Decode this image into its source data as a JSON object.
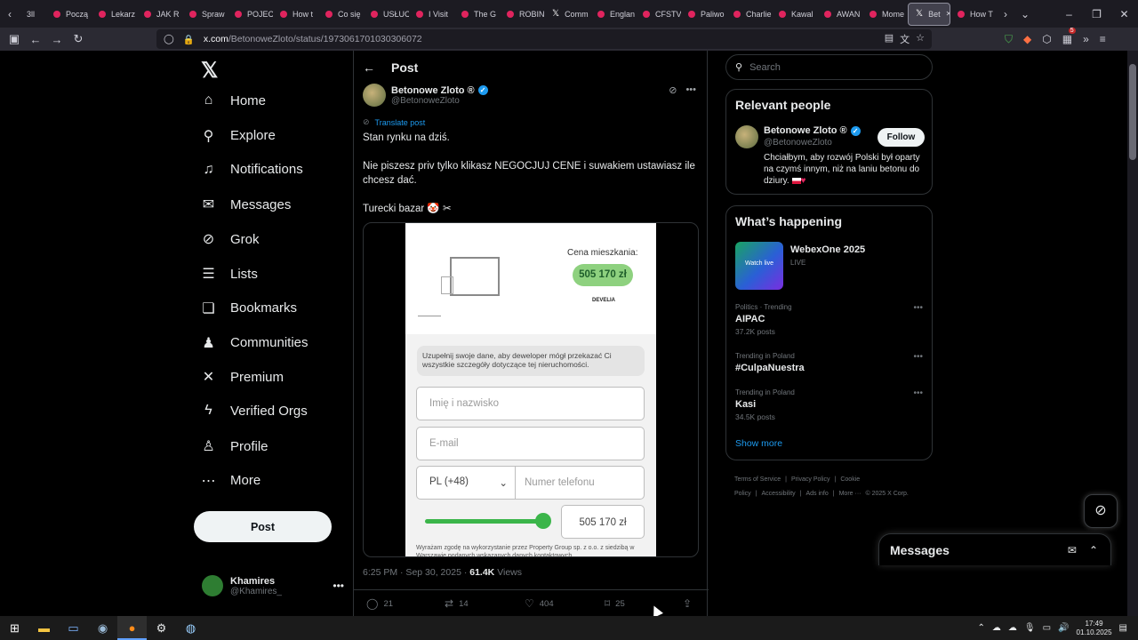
{
  "browser": {
    "tabs": [
      {
        "label": "3ll",
        "kind": "leading"
      },
      {
        "label": "Począ",
        "kind": "red"
      },
      {
        "label": "Lekarz",
        "kind": "red"
      },
      {
        "label": "JAK R",
        "kind": "red"
      },
      {
        "label": "Spraw",
        "kind": "red"
      },
      {
        "label": "POJEC",
        "kind": "red"
      },
      {
        "label": "How t",
        "kind": "red"
      },
      {
        "label": "Co się",
        "kind": "red"
      },
      {
        "label": "USŁUC",
        "kind": "red"
      },
      {
        "label": "I Visit",
        "kind": "red"
      },
      {
        "label": "The G",
        "kind": "red"
      },
      {
        "label": "ROBIN",
        "kind": "red"
      },
      {
        "label": "Comm",
        "kind": "x"
      },
      {
        "label": "Englan",
        "kind": "red"
      },
      {
        "label": "CFSTV",
        "kind": "red"
      },
      {
        "label": "Paliwo",
        "kind": "red"
      },
      {
        "label": "Charlie",
        "kind": "red"
      },
      {
        "label": "Kawal",
        "kind": "red"
      },
      {
        "label": "AWAN",
        "kind": "red"
      },
      {
        "label": "Mome",
        "kind": "red"
      },
      {
        "label": "Bet",
        "kind": "x-active"
      },
      {
        "label": "How T",
        "kind": "red"
      }
    ],
    "url_domain": "x.com",
    "url_path": "/BetonoweZloto/status/1973061701030306072",
    "notification_badge": "5"
  },
  "nav": {
    "items": [
      {
        "label": "Home",
        "icon": "⌂",
        "name": "home"
      },
      {
        "label": "Explore",
        "icon": "⚲",
        "name": "explore"
      },
      {
        "label": "Notifications",
        "icon": "♫",
        "name": "notifications"
      },
      {
        "label": "Messages",
        "icon": "✉",
        "name": "messages"
      },
      {
        "label": "Grok",
        "icon": "⊘",
        "name": "grok"
      },
      {
        "label": "Lists",
        "icon": "☰",
        "name": "lists"
      },
      {
        "label": "Bookmarks",
        "icon": "❏",
        "name": "bookmarks"
      },
      {
        "label": "Communities",
        "icon": "♟",
        "name": "communities"
      },
      {
        "label": "Premium",
        "icon": "✕",
        "name": "premium"
      },
      {
        "label": "Verified Orgs",
        "icon": "ϟ",
        "name": "verified-orgs"
      },
      {
        "label": "Profile",
        "icon": "♙",
        "name": "profile"
      },
      {
        "label": "More",
        "icon": "⋯",
        "name": "more"
      }
    ],
    "post_button": "Post",
    "account": {
      "name": "Khamires",
      "handle": "@Khamires_"
    }
  },
  "post": {
    "header_title": "Post",
    "author_name": "Betonowe Zloto ®",
    "author_handle": "@BetonoweZloto",
    "translate": "Translate post",
    "text_line1": "Stan rynku na dziś.",
    "text_line2": "Nie piszesz priv tylko klikasz NEGOCJUJ CENE i suwakiem ustawiasz ile chcesz dać.",
    "text_line3": "Turecki bazar 🤡 ✂",
    "image": {
      "price_label": "Cena mieszkania:",
      "price": "505 170 zł",
      "developer": "DEVELIA",
      "notice": "Uzupełnij swoje dane, aby deweloper mógł przekazać Ci wszystkie szczegóły dotyczące tej nieruchomości.",
      "name_placeholder": "Imię i nazwisko",
      "email_placeholder": "E-mail",
      "phone_prefix": "PL (+48)",
      "phone_placeholder": "Numer telefonu",
      "slider_amount": "505 170 zł",
      "consent": "Wyrażam zgodę na wykorzystanie przez Property Group sp. z o.o. z siedzibą w Warszawie podanych wskazanych danych kontaktowych"
    },
    "timestamp": "6:25 PM · Sep 30, 2025 · ",
    "views": "61.4K",
    "views_label": " Views",
    "replies": "21",
    "reposts": "14",
    "likes": "404",
    "bookmarks": "25"
  },
  "right": {
    "search_placeholder": "Search",
    "relevant_title": "Relevant people",
    "rp_name": "Betonowe Zloto ®",
    "rp_handle": "@BetonoweZloto",
    "rp_follow": "Follow",
    "rp_bio": "Chciałbym, aby rozwój Polski był oparty na czymś innym, niż na laniu betonu do dziury.",
    "happening_title": "What’s happening",
    "event_title": "WebexOne 2025",
    "event_status": "LIVE",
    "event_thumb": "Watch live",
    "trends": [
      {
        "context": "Politics · Trending",
        "name": "AIPAC",
        "posts": "37.2K posts"
      },
      {
        "context": "Trending in Poland",
        "name": "#CulpaNuestra",
        "posts": ""
      },
      {
        "context": "Trending in Poland",
        "name": "Kasi",
        "posts": "34.5K posts"
      }
    ],
    "show_more": "Show more",
    "footer": [
      "Terms of Service",
      "|",
      "Privacy Policy",
      "|",
      "Cookie Policy",
      "|",
      "Accessibility",
      "|",
      "Ads info",
      "|",
      "More ···",
      "© 2025 X Corp."
    ]
  },
  "messages_drawer": {
    "title": "Messages"
  },
  "taskbar": {
    "time": "17:49",
    "date": "01.10.2025"
  }
}
